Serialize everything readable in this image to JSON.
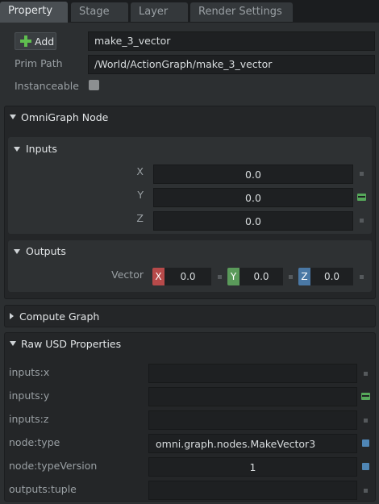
{
  "tabs": [
    {
      "label": "Property",
      "active": true
    },
    {
      "label": "Stage",
      "active": false
    },
    {
      "label": "Layer",
      "active": false
    },
    {
      "label": "Render Settings",
      "active": false
    }
  ],
  "header": {
    "add_label": "Add",
    "prim_name": "make_3_vector",
    "prim_path_label": "Prim Path",
    "prim_path": "/World/ActionGraph/make_3_vector",
    "instanceable_label": "Instanceable",
    "instanceable_checked": false
  },
  "omnigraph": {
    "title": "OmniGraph Node",
    "inputs_title": "Inputs",
    "inputs": [
      {
        "label": "X",
        "value": "0.0"
      },
      {
        "label": "Y",
        "value": "0.0"
      },
      {
        "label": "Z",
        "value": "0.0"
      }
    ],
    "outputs_title": "Outputs",
    "vector_label": "Vector",
    "vector": {
      "x_axis": "X",
      "x": "0.0",
      "y_axis": "Y",
      "y": "0.0",
      "z_axis": "Z",
      "z": "0.0"
    }
  },
  "compute_graph": {
    "title": "Compute Graph"
  },
  "raw_usd": {
    "title": "Raw USD Properties",
    "props": [
      {
        "label": "inputs:x",
        "value": ""
      },
      {
        "label": "inputs:y",
        "value": ""
      },
      {
        "label": "inputs:z",
        "value": ""
      },
      {
        "label": "node:type",
        "value": "omni.graph.nodes.MakeVector3"
      },
      {
        "label": "node:typeVersion",
        "value": "1"
      },
      {
        "label": "outputs:tuple",
        "value": ""
      }
    ]
  },
  "colors": {
    "accent_green": "#5fbf4f",
    "connected_green": "#56a85a",
    "attr_blue": "#4f86b5",
    "axis_x": "#b74a4a",
    "axis_y": "#5a9a5a",
    "axis_z": "#4a78a5"
  }
}
